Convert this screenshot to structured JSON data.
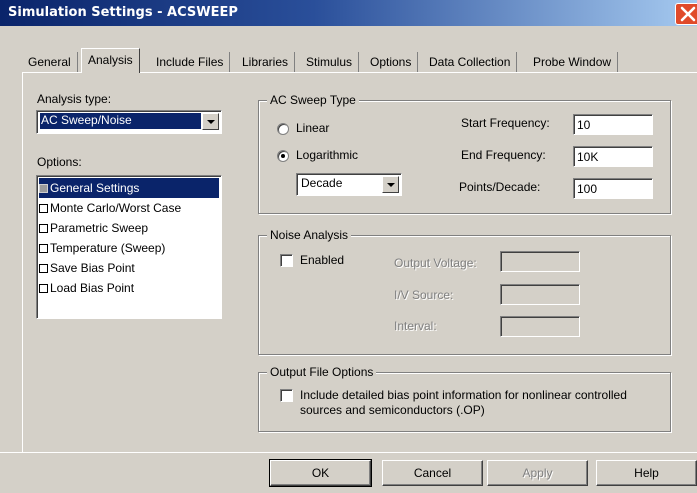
{
  "window": {
    "title": "Simulation Settings - ACSWEEP"
  },
  "tabs": [
    {
      "label": "General"
    },
    {
      "label": "Analysis",
      "active": true
    },
    {
      "label": "Include Files"
    },
    {
      "label": "Libraries"
    },
    {
      "label": "Stimulus"
    },
    {
      "label": "Options"
    },
    {
      "label": "Data Collection"
    },
    {
      "label": "Probe Window"
    }
  ],
  "analysis_type": {
    "label": "Analysis type:",
    "selected": "AC Sweep/Noise"
  },
  "options": {
    "label": "Options:",
    "items": [
      {
        "label": "General Settings",
        "checked": true,
        "selected": true
      },
      {
        "label": "Monte Carlo/Worst Case",
        "checked": false
      },
      {
        "label": "Parametric Sweep",
        "checked": false
      },
      {
        "label": "Temperature (Sweep)",
        "checked": false
      },
      {
        "label": "Save Bias Point",
        "checked": false
      },
      {
        "label": "Load Bias Point",
        "checked": false
      }
    ]
  },
  "ac_sweep": {
    "title": "AC Sweep Type",
    "linear_label": "Linear",
    "log_label": "Logarithmic",
    "selected_type": "Logarithmic",
    "log_scale": "Decade",
    "start_freq_label": "Start Frequency:",
    "start_freq": "10",
    "end_freq_label": "End Frequency:",
    "end_freq": "10K",
    "points_label": "Points/Decade:",
    "points": "100"
  },
  "noise": {
    "title": "Noise Analysis",
    "enabled_label": "Enabled",
    "enabled": false,
    "output_voltage_label": "Output Voltage:",
    "output_voltage": "",
    "source_label": "I/V Source:",
    "source": "",
    "interval_label": "Interval:",
    "interval": ""
  },
  "output_file": {
    "title": "Output File Options",
    "op_label_line1": "Include detailed bias point information for nonlinear controlled",
    "op_label_line2": "sources and semiconductors (.OP)",
    "op_checked": false
  },
  "buttons": {
    "ok": "OK",
    "cancel": "Cancel",
    "apply": "Apply",
    "help": "Help"
  },
  "icons": {
    "close": "close-icon"
  }
}
